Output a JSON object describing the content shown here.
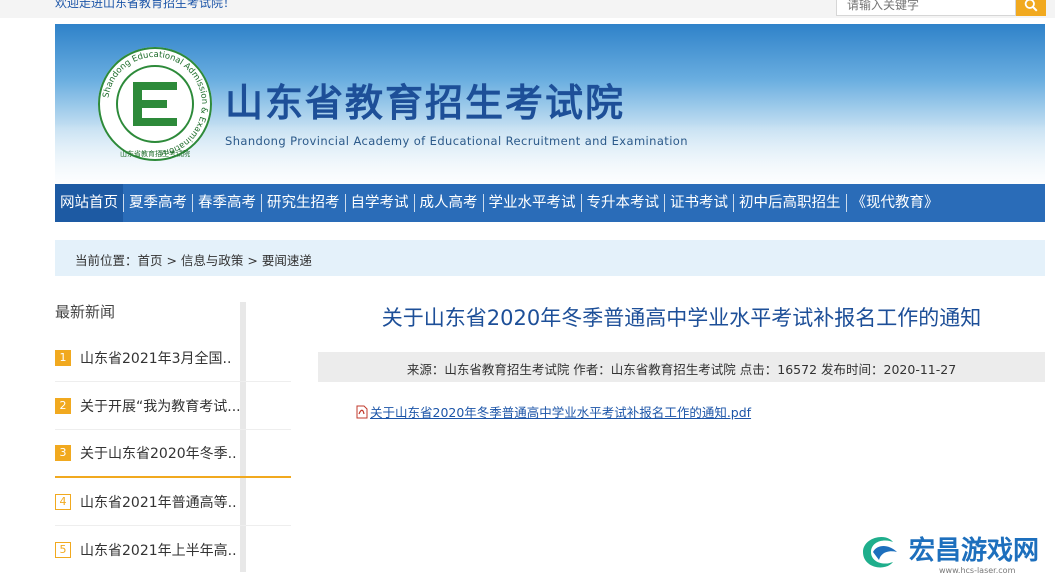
{
  "topbar": {
    "welcome": "欢迎走进山东省教育招生考试院！",
    "search_placeholder": "请输入关键字",
    "search_icon": "search-icon"
  },
  "header": {
    "title": "山东省教育招生考试院",
    "subtitle": "Shandong Provincial Academy of Educational Recruitment and Examination",
    "logo_ring_text": "Shandong Educational Admission & Examinations",
    "logo_letter": "E",
    "logo_cn": "山东省教育招生考试院"
  },
  "nav": {
    "items": [
      {
        "label": "网站首页",
        "active": true
      },
      {
        "label": "夏季高考"
      },
      {
        "label": "春季高考"
      },
      {
        "label": "研究生招考"
      },
      {
        "label": "自学考试"
      },
      {
        "label": "成人高考"
      },
      {
        "label": "学业水平考试"
      },
      {
        "label": "专升本考试"
      },
      {
        "label": "证书考试"
      },
      {
        "label": "初中后高职招生"
      },
      {
        "label": "《现代教育》"
      }
    ]
  },
  "breadcrumb": "当前位置：首页 > 信息与政策 > 要闻速递",
  "sidebar": {
    "title": "最新新闻",
    "items": [
      {
        "num": "1",
        "text": "山东省2021年3月全国.."
      },
      {
        "num": "2",
        "text": "关于开展“我为教育考试..."
      },
      {
        "num": "3",
        "text": "关于山东省2020年冬季.."
      },
      {
        "num": "4",
        "text": "山东省2021年普通高等.."
      },
      {
        "num": "5",
        "text": "山东省2021年上半年高.."
      }
    ]
  },
  "article": {
    "title": "关于山东省2020年冬季普通高中学业水平考试补报名工作的通知",
    "meta": "来源：山东省教育招生考试院 作者：山东省教育招生考试院 点击：16572 发布时间：2020-11-27",
    "attachment": "关于山东省2020年冬季普通高中学业水平考试补报名工作的通知.pdf",
    "attachment_icon": "pdf-icon"
  },
  "watermark": {
    "title": "宏昌游戏网",
    "url": "www.hcs-laser.com"
  },
  "colors": {
    "nav_bg": "#2a6cb8",
    "title_blue": "#1d4f98",
    "accent_orange": "#f1a91f",
    "breadcrumb_bg": "#e4f1fa"
  }
}
